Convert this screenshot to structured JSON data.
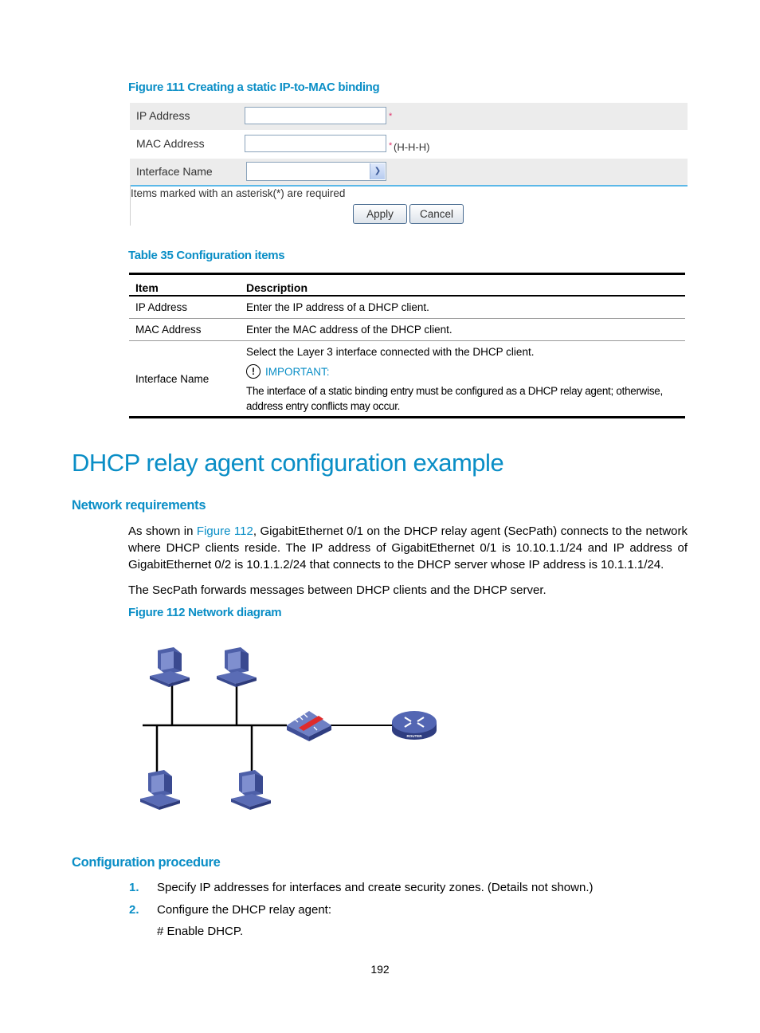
{
  "figure111": {
    "caption": "Figure 111 Creating a static IP-to-MAC binding",
    "fields": [
      {
        "label": "IP Address",
        "value": "",
        "suffix": "*"
      },
      {
        "label": "MAC Address",
        "value": "",
        "suffix": "*",
        "hint": "(H-H-H)"
      },
      {
        "label": "Interface Name",
        "selected": ""
      }
    ],
    "required_note": "Items marked with an asterisk(*) are required",
    "apply_label": "Apply",
    "cancel_label": "Cancel",
    "dropdown_icon": "chevron-down-icon"
  },
  "table35": {
    "caption": "Table 35 Configuration items",
    "headers": [
      "Item",
      "Description"
    ],
    "rows": [
      {
        "item": "IP Address",
        "description": "Enter the IP address of a DHCP client."
      },
      {
        "item": "MAC Address",
        "description": "Enter the MAC address of the DHCP client."
      },
      {
        "item": "Interface Name",
        "description": "Select the Layer 3 interface connected with the DHCP client.",
        "important_label": "IMPORTANT:",
        "important_icon": "exclamation-circle-icon",
        "important_text": "The interface of a static binding entry must be configured as a DHCP relay agent; otherwise, address entry conflicts may occur."
      }
    ]
  },
  "section": {
    "title": "DHCP relay agent configuration example",
    "network_requirements": {
      "heading": "Network requirements",
      "para1_prefix": "As shown in ",
      "para1_link": "Figure 112",
      "para1_rest": ", GigabitEthernet 0/1 on the DHCP relay agent (SecPath) connects to the network where DHCP clients reside. The IP address of GigabitEthernet 0/1 is 10.10.1.1/24 and IP address of GigabitEthernet 0/2 is 10.1.1.2/24 that connects to the DHCP server whose IP address is 10.1.1.1/24.",
      "para2": "The SecPath forwards messages between DHCP clients and the DHCP server."
    },
    "figure112": {
      "caption": "Figure 112 Network diagram",
      "nodes": [
        "pc-1",
        "pc-2",
        "pc-3",
        "pc-4",
        "firewall-secpath",
        "router"
      ],
      "router_label": "ROUTER"
    },
    "configuration_procedure": {
      "heading": "Configuration procedure",
      "steps": [
        {
          "num": "1.",
          "text": "Specify IP addresses for interfaces and create security zones. (Details not shown.)"
        },
        {
          "num": "2.",
          "text": "Configure the DHCP relay agent:"
        }
      ],
      "comment": "# Enable DHCP."
    }
  },
  "page_number": "192"
}
